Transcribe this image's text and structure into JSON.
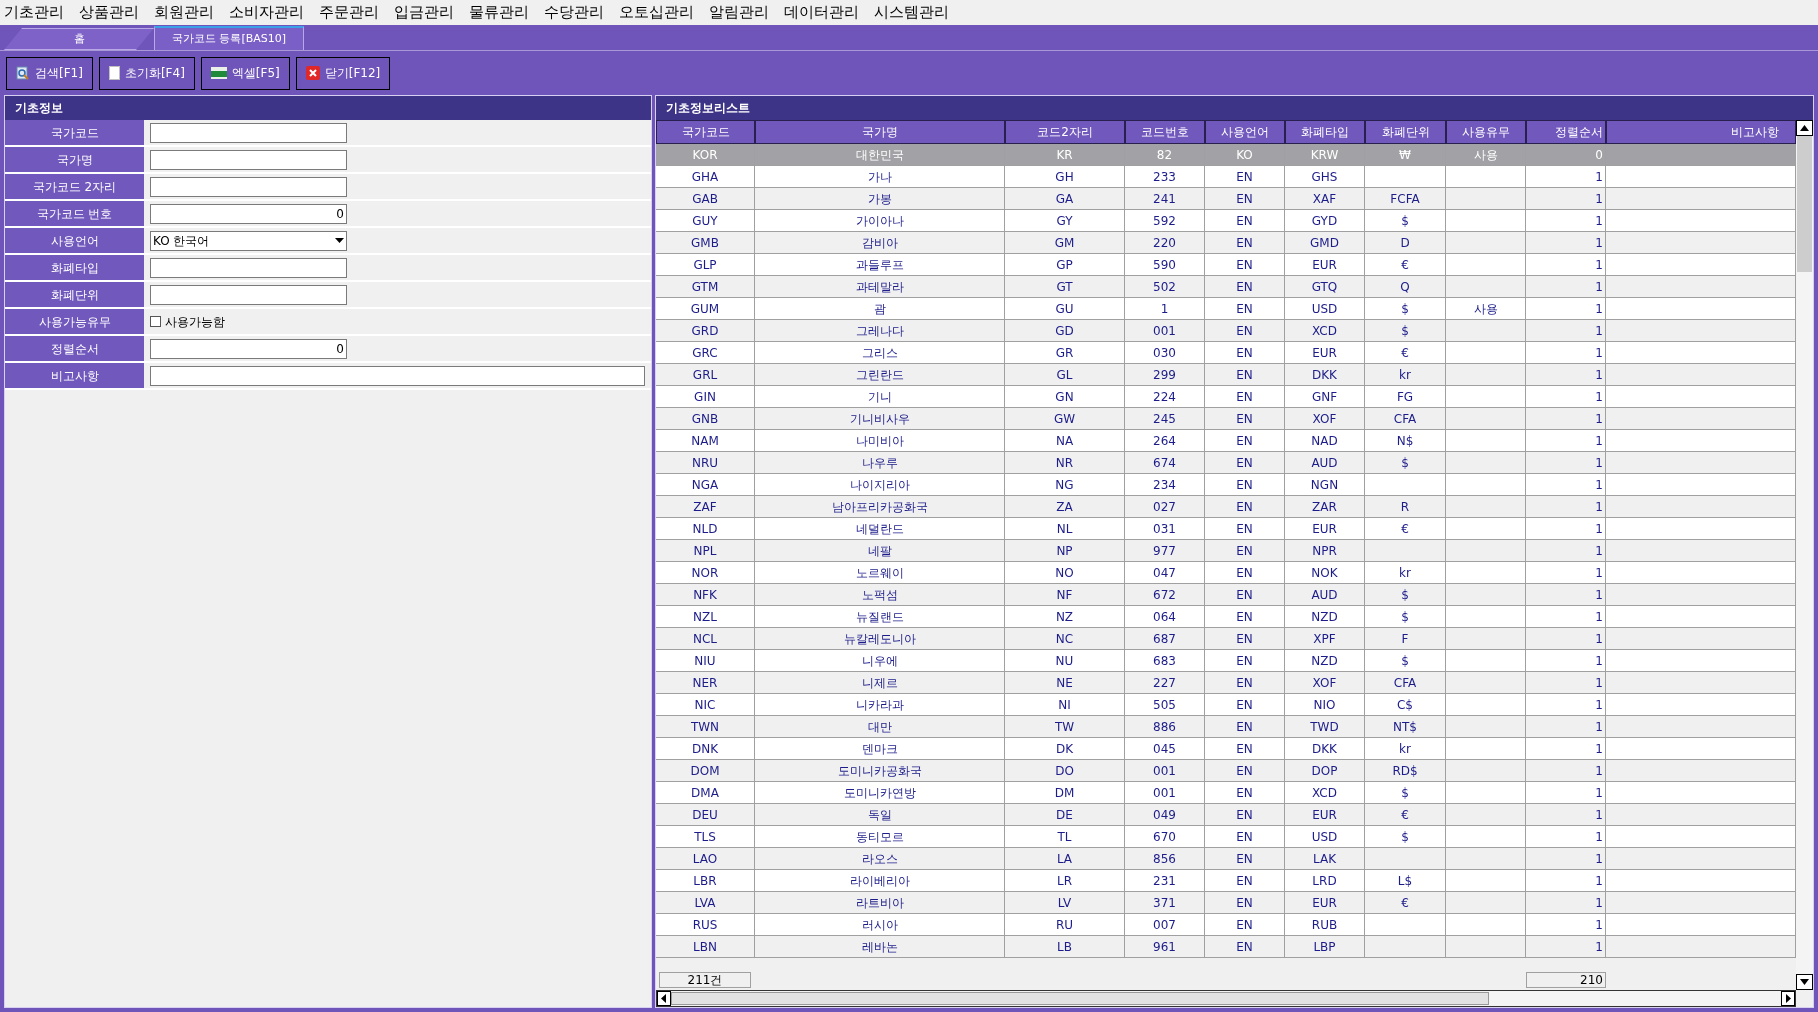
{
  "menu": [
    "기초관리",
    "상품관리",
    "회원관리",
    "소비자관리",
    "주문관리",
    "입금관리",
    "물류관리",
    "수당관리",
    "오토십관리",
    "알림관리",
    "데이터관리",
    "시스템관리"
  ],
  "tabs": [
    {
      "label": "홈",
      "selected": false
    },
    {
      "label": "국가코드 등록[BAS10]",
      "selected": true
    }
  ],
  "toolbar": [
    {
      "kind": "search",
      "label": "검색[F1]"
    },
    {
      "kind": "reset",
      "label": "초기화[F4]"
    },
    {
      "kind": "excel",
      "label": "엑셀[F5]"
    },
    {
      "kind": "close",
      "label": "닫기[F12]"
    }
  ],
  "form": {
    "title": "기초정보",
    "fields": [
      {
        "label": "국가코드",
        "kind": "text"
      },
      {
        "label": "국가명",
        "kind": "text"
      },
      {
        "label": "국가코드 2자리",
        "kind": "text"
      },
      {
        "label": "국가코드 번호",
        "kind": "number",
        "value": "0"
      },
      {
        "label": "사용언어",
        "kind": "select",
        "value": "KO 한국어"
      },
      {
        "label": "화폐타입",
        "kind": "text"
      },
      {
        "label": "화폐단위",
        "kind": "text"
      },
      {
        "label": "사용가능유무",
        "kind": "checkbox",
        "option": "사용가능함",
        "checked": false
      },
      {
        "label": "정렬순서",
        "kind": "number",
        "value": "0"
      },
      {
        "label": "비고사항",
        "kind": "wide"
      }
    ]
  },
  "list": {
    "title": "기초정보리스트",
    "columns": [
      "국가코드",
      "국가명",
      "코드2자리",
      "코드번호",
      "사용언어",
      "화폐타입",
      "화폐단위",
      "사용유무",
      "정렬순서",
      "비고사항"
    ],
    "rows": [
      {
        "selected": true,
        "cells": [
          "KOR",
          "대한민국",
          "KR",
          "82",
          "KO",
          "KRW",
          "₩",
          "사용",
          "0"
        ]
      },
      {
        "selected": false,
        "cells": [
          "GHA",
          "가나",
          "GH",
          "233",
          "EN",
          "GHS",
          "",
          "",
          "1"
        ]
      },
      {
        "selected": false,
        "cells": [
          "GAB",
          "가봉",
          "GA",
          "241",
          "EN",
          "XAF",
          "FCFA",
          "",
          "1"
        ]
      },
      {
        "selected": false,
        "cells": [
          "GUY",
          "가이아나",
          "GY",
          "592",
          "EN",
          "GYD",
          "$",
          "",
          "1"
        ]
      },
      {
        "selected": false,
        "cells": [
          "GMB",
          "감비아",
          "GM",
          "220",
          "EN",
          "GMD",
          "D",
          "",
          "1"
        ]
      },
      {
        "selected": false,
        "cells": [
          "GLP",
          "과들루프",
          "GP",
          "590",
          "EN",
          "EUR",
          "€",
          "",
          "1"
        ]
      },
      {
        "selected": false,
        "cells": [
          "GTM",
          "과테말라",
          "GT",
          "502",
          "EN",
          "GTQ",
          "Q",
          "",
          "1"
        ]
      },
      {
        "selected": false,
        "cells": [
          "GUM",
          "괌",
          "GU",
          "1",
          "EN",
          "USD",
          "$",
          "사용",
          "1"
        ]
      },
      {
        "selected": false,
        "cells": [
          "GRD",
          "그레나다",
          "GD",
          "001",
          "EN",
          "XCD",
          "$",
          "",
          "1"
        ]
      },
      {
        "selected": false,
        "cells": [
          "GRC",
          "그리스",
          "GR",
          "030",
          "EN",
          "EUR",
          "€",
          "",
          "1"
        ]
      },
      {
        "selected": false,
        "cells": [
          "GRL",
          "그린란드",
          "GL",
          "299",
          "EN",
          "DKK",
          "kr",
          "",
          "1"
        ]
      },
      {
        "selected": false,
        "cells": [
          "GIN",
          "기니",
          "GN",
          "224",
          "EN",
          "GNF",
          "FG",
          "",
          "1"
        ]
      },
      {
        "selected": false,
        "cells": [
          "GNB",
          "기니비사우",
          "GW",
          "245",
          "EN",
          "XOF",
          "CFA",
          "",
          "1"
        ]
      },
      {
        "selected": false,
        "cells": [
          "NAM",
          "나미비아",
          "NA",
          "264",
          "EN",
          "NAD",
          "N$",
          "",
          "1"
        ]
      },
      {
        "selected": false,
        "cells": [
          "NRU",
          "나우루",
          "NR",
          "674",
          "EN",
          "AUD",
          "$",
          "",
          "1"
        ]
      },
      {
        "selected": false,
        "cells": [
          "NGA",
          "나이지리아",
          "NG",
          "234",
          "EN",
          "NGN",
          "",
          "",
          "1"
        ]
      },
      {
        "selected": false,
        "cells": [
          "ZAF",
          "남아프리카공화국",
          "ZA",
          "027",
          "EN",
          "ZAR",
          "R",
          "",
          "1"
        ]
      },
      {
        "selected": false,
        "cells": [
          "NLD",
          "네덜란드",
          "NL",
          "031",
          "EN",
          "EUR",
          "€",
          "",
          "1"
        ]
      },
      {
        "selected": false,
        "cells": [
          "NPL",
          "네팔",
          "NP",
          "977",
          "EN",
          "NPR",
          "",
          "",
          "1"
        ]
      },
      {
        "selected": false,
        "cells": [
          "NOR",
          "노르웨이",
          "NO",
          "047",
          "EN",
          "NOK",
          "kr",
          "",
          "1"
        ]
      },
      {
        "selected": false,
        "cells": [
          "NFK",
          "노퍽섬",
          "NF",
          "672",
          "EN",
          "AUD",
          "$",
          "",
          "1"
        ]
      },
      {
        "selected": false,
        "cells": [
          "NZL",
          "뉴질랜드",
          "NZ",
          "064",
          "EN",
          "NZD",
          "$",
          "",
          "1"
        ]
      },
      {
        "selected": false,
        "cells": [
          "NCL",
          "뉴칼레도니아",
          "NC",
          "687",
          "EN",
          "XPF",
          "F",
          "",
          "1"
        ]
      },
      {
        "selected": false,
        "cells": [
          "NIU",
          "니우에",
          "NU",
          "683",
          "EN",
          "NZD",
          "$",
          "",
          "1"
        ]
      },
      {
        "selected": false,
        "cells": [
          "NER",
          "니제르",
          "NE",
          "227",
          "EN",
          "XOF",
          "CFA",
          "",
          "1"
        ]
      },
      {
        "selected": false,
        "cells": [
          "NIC",
          "니카라과",
          "NI",
          "505",
          "EN",
          "NIO",
          "C$",
          "",
          "1"
        ]
      },
      {
        "selected": false,
        "cells": [
          "TWN",
          "대만",
          "TW",
          "886",
          "EN",
          "TWD",
          "NT$",
          "",
          "1"
        ]
      },
      {
        "selected": false,
        "cells": [
          "DNK",
          "덴마크",
          "DK",
          "045",
          "EN",
          "DKK",
          "kr",
          "",
          "1"
        ]
      },
      {
        "selected": false,
        "cells": [
          "DOM",
          "도미니카공화국",
          "DO",
          "001",
          "EN",
          "DOP",
          "RD$",
          "",
          "1"
        ]
      },
      {
        "selected": false,
        "cells": [
          "DMA",
          "도미니카연방",
          "DM",
          "001",
          "EN",
          "XCD",
          "$",
          "",
          "1"
        ]
      },
      {
        "selected": false,
        "cells": [
          "DEU",
          "독일",
          "DE",
          "049",
          "EN",
          "EUR",
          "€",
          "",
          "1"
        ]
      },
      {
        "selected": false,
        "cells": [
          "TLS",
          "동티모르",
          "TL",
          "670",
          "EN",
          "USD",
          "$",
          "",
          "1"
        ]
      },
      {
        "selected": false,
        "cells": [
          "LAO",
          "라오스",
          "LA",
          "856",
          "EN",
          "LAK",
          "",
          "",
          "1"
        ]
      },
      {
        "selected": false,
        "cells": [
          "LBR",
          "라이베리아",
          "LR",
          "231",
          "EN",
          "LRD",
          "L$",
          "",
          "1"
        ]
      },
      {
        "selected": false,
        "cells": [
          "LVA",
          "라트비아",
          "LV",
          "371",
          "EN",
          "EUR",
          "€",
          "",
          "1"
        ]
      },
      {
        "selected": false,
        "cells": [
          "RUS",
          "러시아",
          "RU",
          "007",
          "EN",
          "RUB",
          "",
          "",
          "1"
        ]
      },
      {
        "selected": false,
        "cells": [
          "LBN",
          "레바논",
          "LB",
          "961",
          "EN",
          "LBP",
          "",
          "",
          "1"
        ]
      }
    ],
    "footer": {
      "count": "211건",
      "sum": "210"
    }
  }
}
